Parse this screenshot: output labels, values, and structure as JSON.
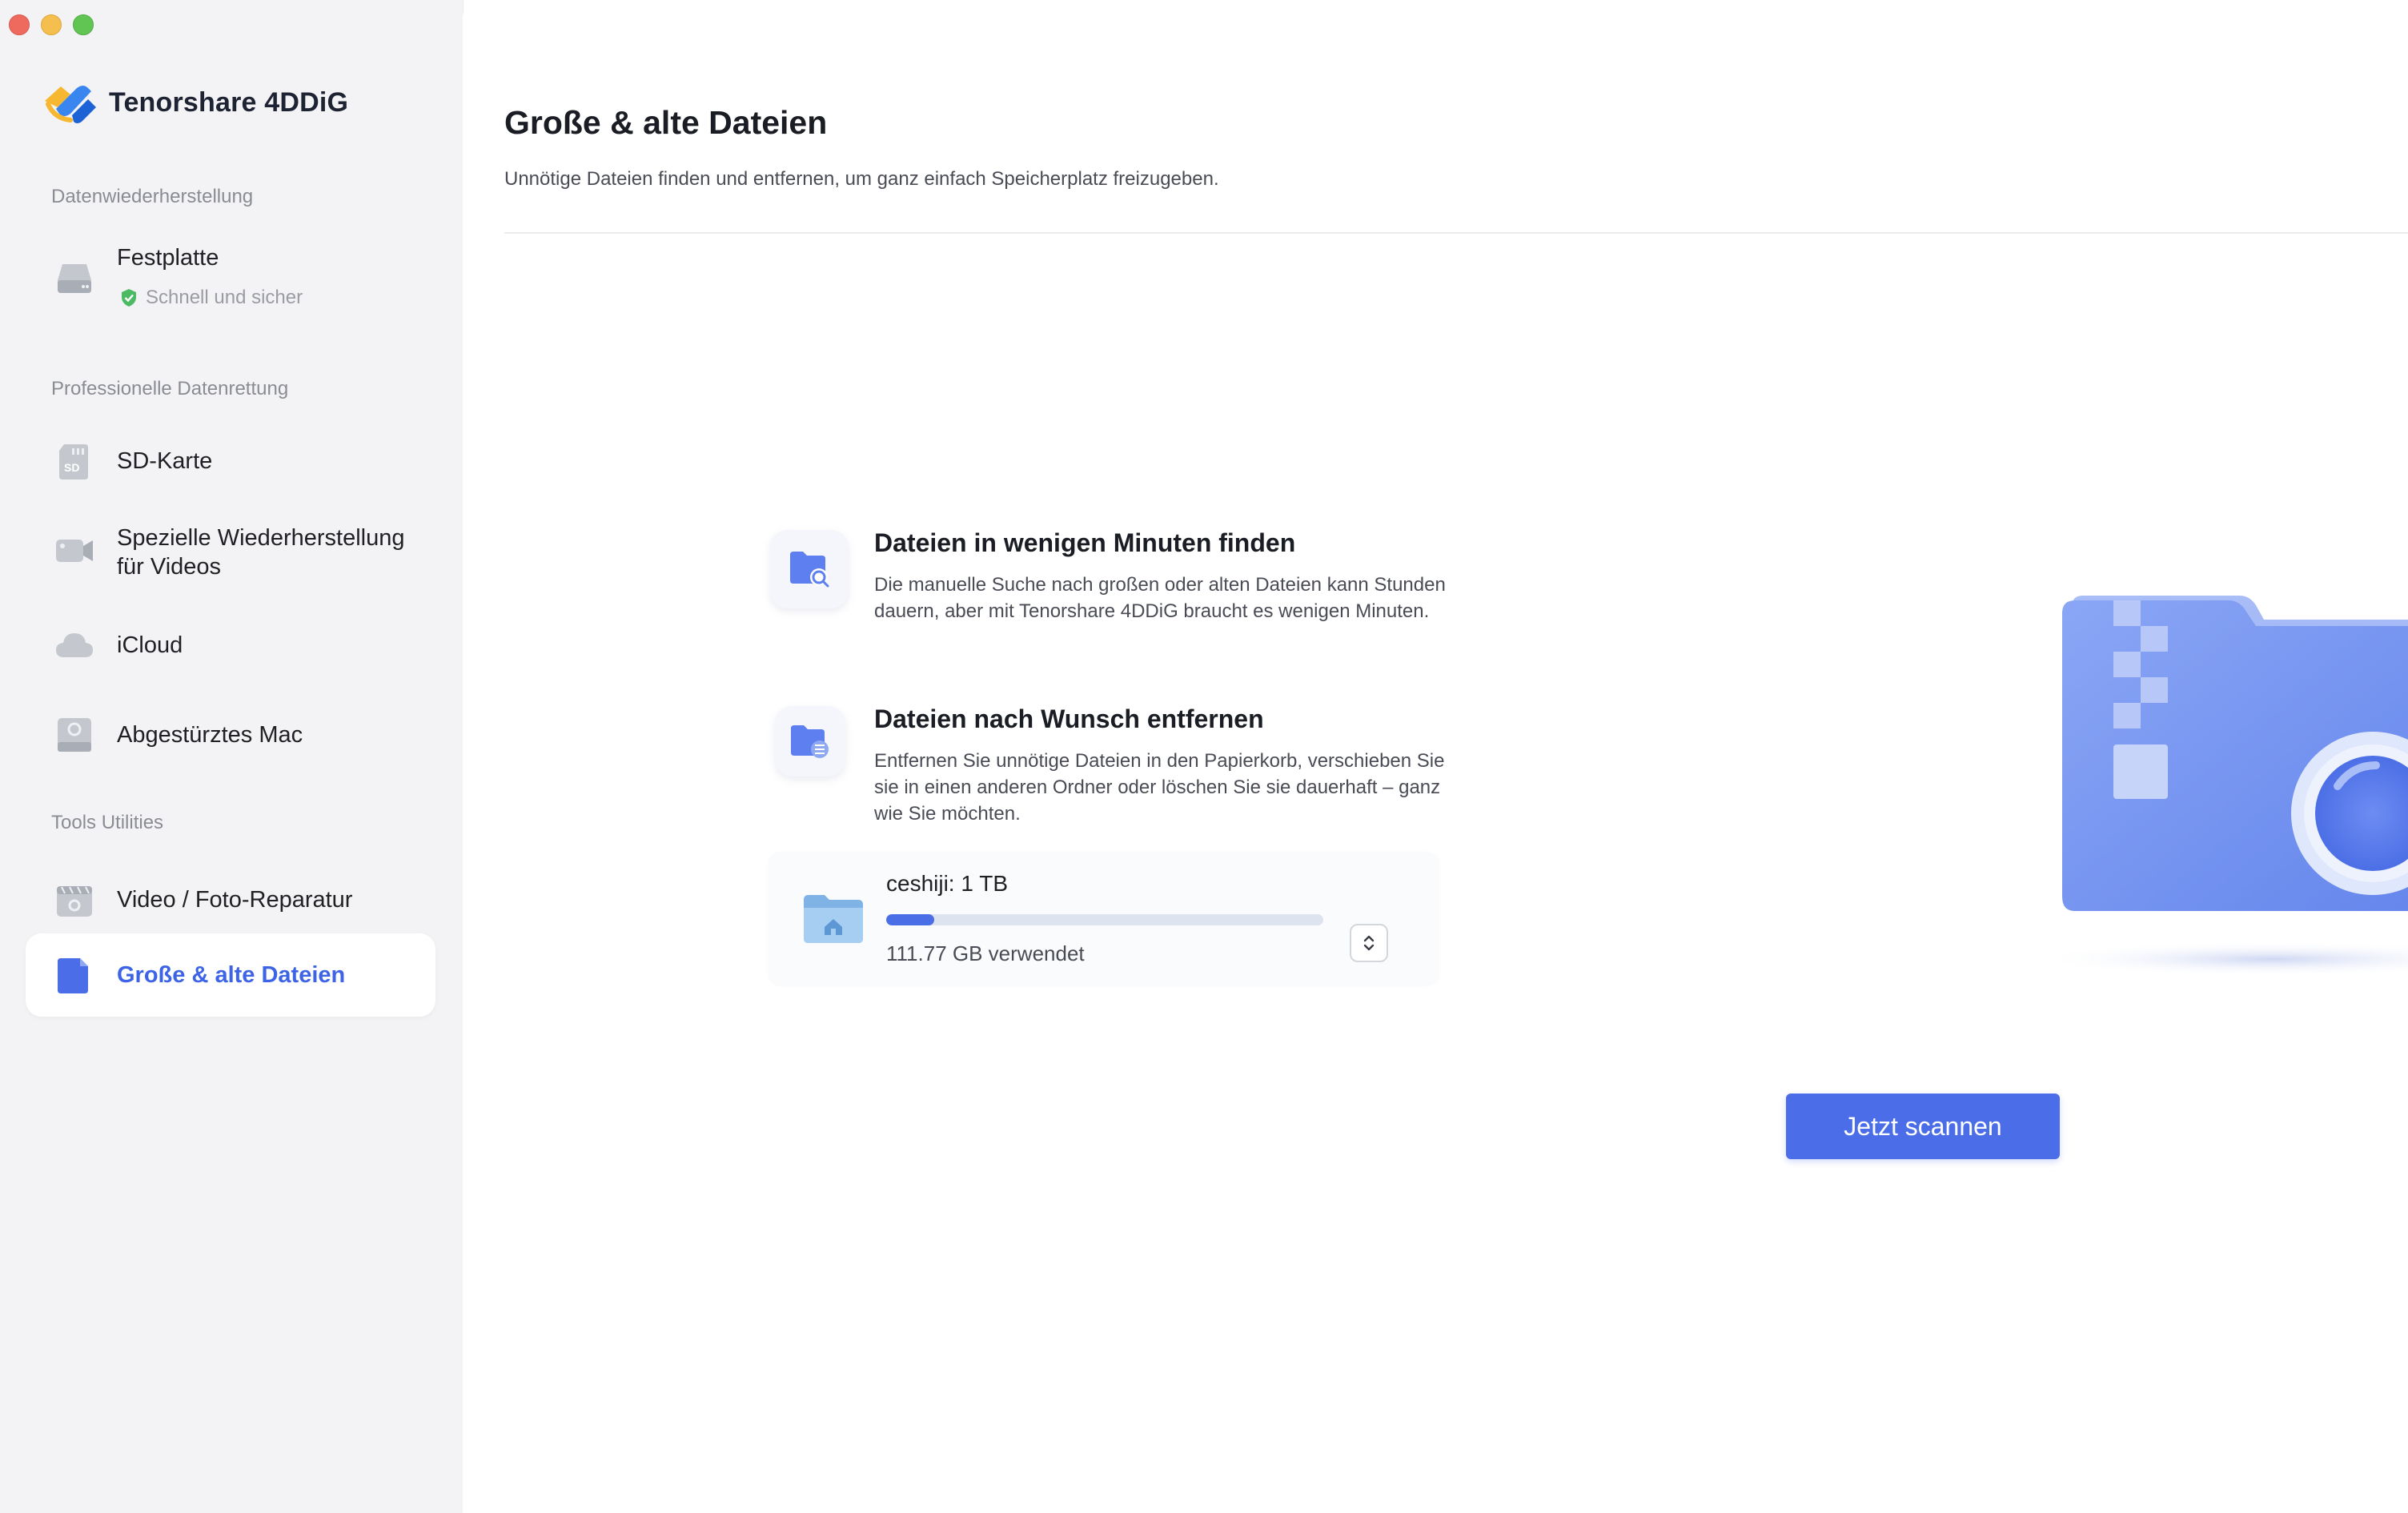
{
  "window": {
    "controls": [
      "close",
      "minimize",
      "zoom"
    ]
  },
  "brand": {
    "name": "Tenorshare 4DDiG",
    "icon": "4ddig-logo-icon"
  },
  "sidebar": {
    "sections": [
      {
        "label": "Datenwiederherstellung"
      },
      {
        "label": "Professionelle Datenrettung"
      },
      {
        "label": "Tools  Utilities"
      }
    ],
    "items": [
      {
        "label": "Festplatte",
        "icon": "hard-drive-icon",
        "badge": "Schnell und sicher",
        "badge_icon": "shield-check-icon"
      },
      {
        "label": "SD-Karte",
        "icon": "sd-card-icon"
      },
      {
        "label": "Spezielle Wiederherstellung",
        "label2": "für Videos",
        "icon": "video-camera-icon"
      },
      {
        "label": "iCloud",
        "icon": "cloud-icon"
      },
      {
        "label": "Abgestürztes Mac",
        "icon": "crashed-mac-icon"
      },
      {
        "label": "Video / Foto-Reparatur",
        "icon": "repair-icon"
      },
      {
        "label": "Große & alte Dateien",
        "icon": "file-icon",
        "active": true
      }
    ]
  },
  "main": {
    "title": "Große & alte Dateien",
    "subtitle": "Unnötige Dateien finden und entfernen, um ganz einfach Speicherplatz freizugeben.",
    "features": [
      {
        "title": "Dateien in wenigen Minuten finden",
        "desc": "Die manuelle Suche nach großen oder alten Dateien kann Stunden dauern, aber mit Tenorshare 4DDiG braucht es wenigen Minuten.",
        "icon": "folder-search-icon"
      },
      {
        "title": "Dateien nach Wunsch entfernen",
        "desc": "Entfernen Sie unnötige Dateien in den Papierkorb, verschieben Sie sie in einen anderen Ordner oder löschen Sie sie dauerhaft – ganz wie Sie möchten.",
        "icon": "folder-list-icon"
      }
    ],
    "drive": {
      "name": "ceshiji: 1 TB",
      "used": "111.77 GB verwendet",
      "used_fraction": 0.11,
      "icon": "home-folder-icon"
    },
    "scan_button": "Jetzt scannen"
  },
  "colors": {
    "accent": "#4b6ee8",
    "sidebar_bg": "#f3f3f5",
    "active_text": "#3d64e6"
  }
}
